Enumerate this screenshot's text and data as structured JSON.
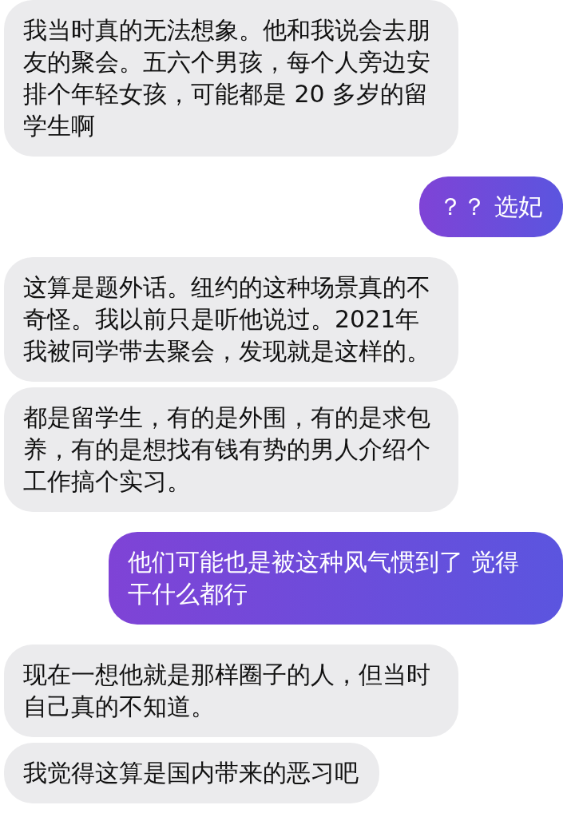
{
  "messages": [
    {
      "kind": "received",
      "text": "我当时真的无法想象。他和我说会去朋友的聚会。五六个男孩，每个人旁边安排个年轻女孩，可能都是 20 多岁的留学生啊"
    },
    {
      "kind": "sent",
      "text": "？？ 选妃"
    },
    {
      "kind": "received",
      "text": "这算是题外话。纽约的这种场景真的不奇怪。我以前只是听他说过。2021年我被同学带去聚会，发现就是这样的。"
    },
    {
      "kind": "received",
      "text": "都是留学生，有的是外围，有的是求包养，有的是想找有钱有势的男人介绍个工作搞个实习。"
    },
    {
      "kind": "sent",
      "text": "他们可能也是被这种风气惯到了 觉得干什么都行"
    },
    {
      "kind": "received",
      "text": "现在一想他就是那样圈子的人，但当时自己真的不知道。"
    },
    {
      "kind": "received",
      "text": "我觉得这算是国内带来的恶习吧"
    }
  ]
}
